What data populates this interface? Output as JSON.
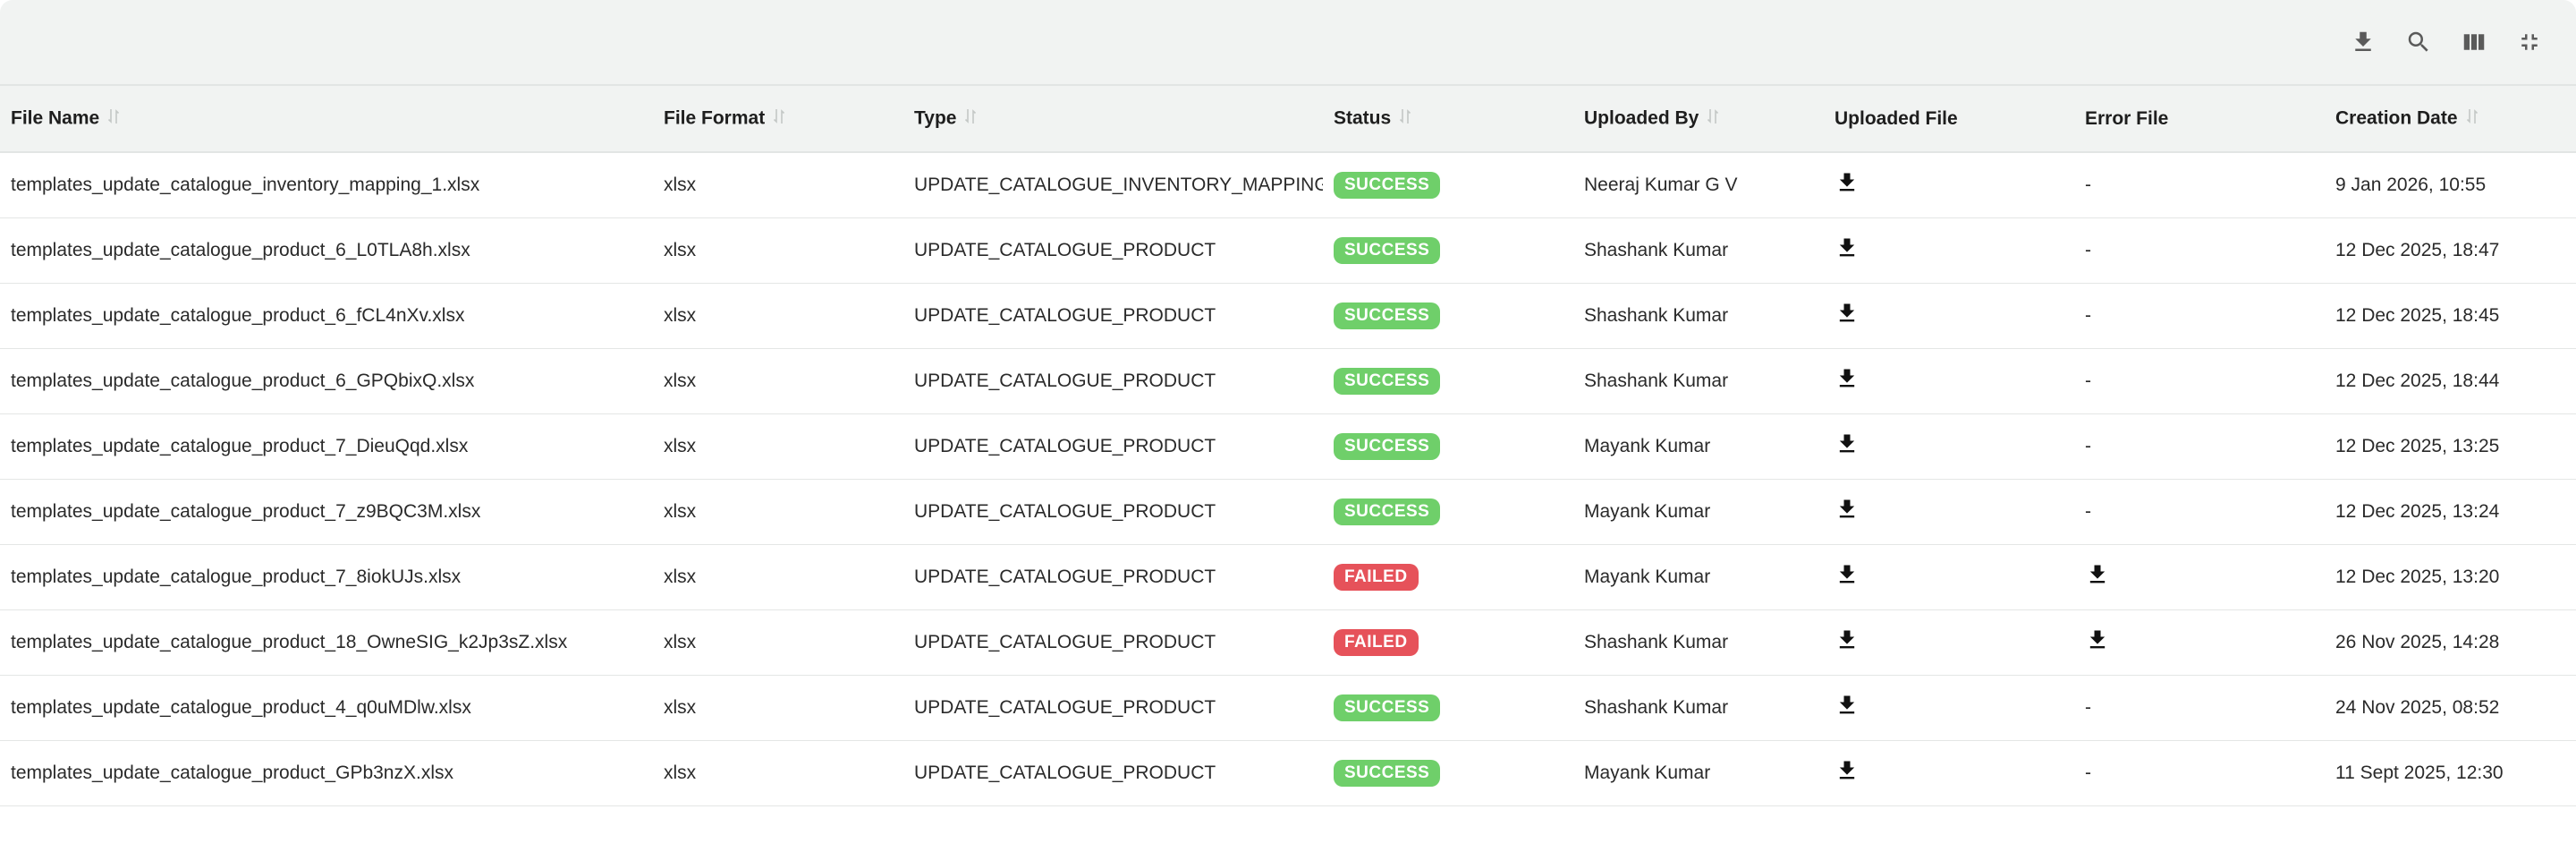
{
  "colors": {
    "success": "#6fcf6a",
    "failed": "#e6525a",
    "header_bg": "#f1f3f2"
  },
  "toolbar": {
    "icons": [
      "download-icon",
      "search-icon",
      "columns-icon",
      "collapse-icon"
    ]
  },
  "columns": [
    {
      "label": "File Name",
      "sortable": true
    },
    {
      "label": "File Format",
      "sortable": true
    },
    {
      "label": "Type",
      "sortable": true
    },
    {
      "label": "Status",
      "sortable": true
    },
    {
      "label": "Uploaded By",
      "sortable": true
    },
    {
      "label": "Uploaded File",
      "sortable": false
    },
    {
      "label": "Error File",
      "sortable": false
    },
    {
      "label": "Creation Date",
      "sortable": true
    }
  ],
  "rows": [
    {
      "file_name": "templates_update_catalogue_inventory_mapping_1.xlsx",
      "format": "xlsx",
      "type": "UPDATE_CATALOGUE_INVENTORY_MAPPING",
      "status": "SUCCESS",
      "uploaded_by": "Neeraj Kumar G V",
      "error_file": "-",
      "date": "9 Jan 2026, 10:55"
    },
    {
      "file_name": "templates_update_catalogue_product_6_L0TLA8h.xlsx",
      "format": "xlsx",
      "type": "UPDATE_CATALOGUE_PRODUCT",
      "status": "SUCCESS",
      "uploaded_by": "Shashank Kumar",
      "error_file": "-",
      "date": "12 Dec 2025, 18:47"
    },
    {
      "file_name": "templates_update_catalogue_product_6_fCL4nXv.xlsx",
      "format": "xlsx",
      "type": "UPDATE_CATALOGUE_PRODUCT",
      "status": "SUCCESS",
      "uploaded_by": "Shashank Kumar",
      "error_file": "-",
      "date": "12 Dec 2025, 18:45"
    },
    {
      "file_name": "templates_update_catalogue_product_6_GPQbixQ.xlsx",
      "format": "xlsx",
      "type": "UPDATE_CATALOGUE_PRODUCT",
      "status": "SUCCESS",
      "uploaded_by": "Shashank Kumar",
      "error_file": "-",
      "date": "12 Dec 2025, 18:44"
    },
    {
      "file_name": "templates_update_catalogue_product_7_DieuQqd.xlsx",
      "format": "xlsx",
      "type": "UPDATE_CATALOGUE_PRODUCT",
      "status": "SUCCESS",
      "uploaded_by": "Mayank Kumar",
      "error_file": "-",
      "date": "12 Dec 2025, 13:25"
    },
    {
      "file_name": "templates_update_catalogue_product_7_z9BQC3M.xlsx",
      "format": "xlsx",
      "type": "UPDATE_CATALOGUE_PRODUCT",
      "status": "SUCCESS",
      "uploaded_by": "Mayank Kumar",
      "error_file": "-",
      "date": "12 Dec 2025, 13:24"
    },
    {
      "file_name": "templates_update_catalogue_product_7_8iokUJs.xlsx",
      "format": "xlsx",
      "type": "UPDATE_CATALOGUE_PRODUCT",
      "status": "FAILED",
      "uploaded_by": "Mayank Kumar",
      "error_file": "download",
      "date": "12 Dec 2025, 13:20"
    },
    {
      "file_name": "templates_update_catalogue_product_18_OwneSIG_k2Jp3sZ.xlsx",
      "format": "xlsx",
      "type": "UPDATE_CATALOGUE_PRODUCT",
      "status": "FAILED",
      "uploaded_by": "Shashank Kumar",
      "error_file": "download",
      "date": "26 Nov 2025, 14:28"
    },
    {
      "file_name": "templates_update_catalogue_product_4_q0uMDlw.xlsx",
      "format": "xlsx",
      "type": "UPDATE_CATALOGUE_PRODUCT",
      "status": "SUCCESS",
      "uploaded_by": "Shashank Kumar",
      "error_file": "-",
      "date": "24 Nov 2025, 08:52"
    },
    {
      "file_name": "templates_update_catalogue_product_GPb3nzX.xlsx",
      "format": "xlsx",
      "type": "UPDATE_CATALOGUE_PRODUCT",
      "status": "SUCCESS",
      "uploaded_by": "Mayank Kumar",
      "error_file": "-",
      "date": "11 Sept 2025, 12:30"
    }
  ]
}
